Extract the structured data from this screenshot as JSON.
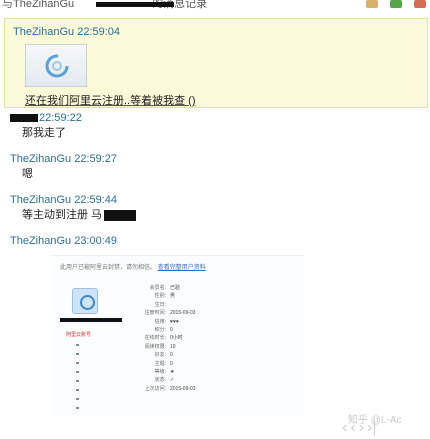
{
  "topbar": {
    "title_fragment": "与TheZihanGu",
    "title_suffix": "的消息记录"
  },
  "highlighted_message": {
    "sender": "TheZihanGu 22:59:04",
    "text": "还在我们阿里云注册..等着被我查 ()"
  },
  "messages": [
    {
      "sender": "22:59:22",
      "text": "那我走了"
    },
    {
      "sender": "TheZihanGu 22:59:27",
      "text": "嗯"
    },
    {
      "sender": "TheZihanGu 22:59:44",
      "text": "等主动到注册 马"
    },
    {
      "sender": "TheZihanGu 23:00:49",
      "text": ""
    }
  ],
  "embed": {
    "header": "此用户已被阿里云封禁，请勿相信。",
    "header_link": "查看完整用户资料",
    "sub_label": "阿里云账号",
    "rows": [
      {
        "k": "会员名:",
        "v": "已验"
      },
      {
        "k": "性别:",
        "v": "男"
      },
      {
        "k": "生日:",
        "v": ""
      },
      {
        "k": "注册时间:",
        "v": "2015-09-03"
      },
      {
        "k": "信用:",
        "v": "♥♥♥"
      },
      {
        "k": "积分:",
        "v": "0"
      },
      {
        "k": "在线时长:",
        "v": "0小时"
      },
      {
        "k": "阅读权限:",
        "v": "10"
      },
      {
        "k": "好友:",
        "v": "0"
      },
      {
        "k": "主题:",
        "v": "0"
      },
      {
        "k": "等级:",
        "v": "★"
      },
      {
        "k": "状态:",
        "v": "✓"
      },
      {
        "k": "上次访问:",
        "v": "2015-09-03"
      }
    ]
  },
  "watermark": "知乎 @L-Ac",
  "nav": [
    "‹",
    "‹",
    "›",
    "›|"
  ],
  "colors": {
    "sender_blue": "#2a6f96",
    "highlight_bg": "#fbfad8",
    "highlight_border": "#e3df9c"
  }
}
